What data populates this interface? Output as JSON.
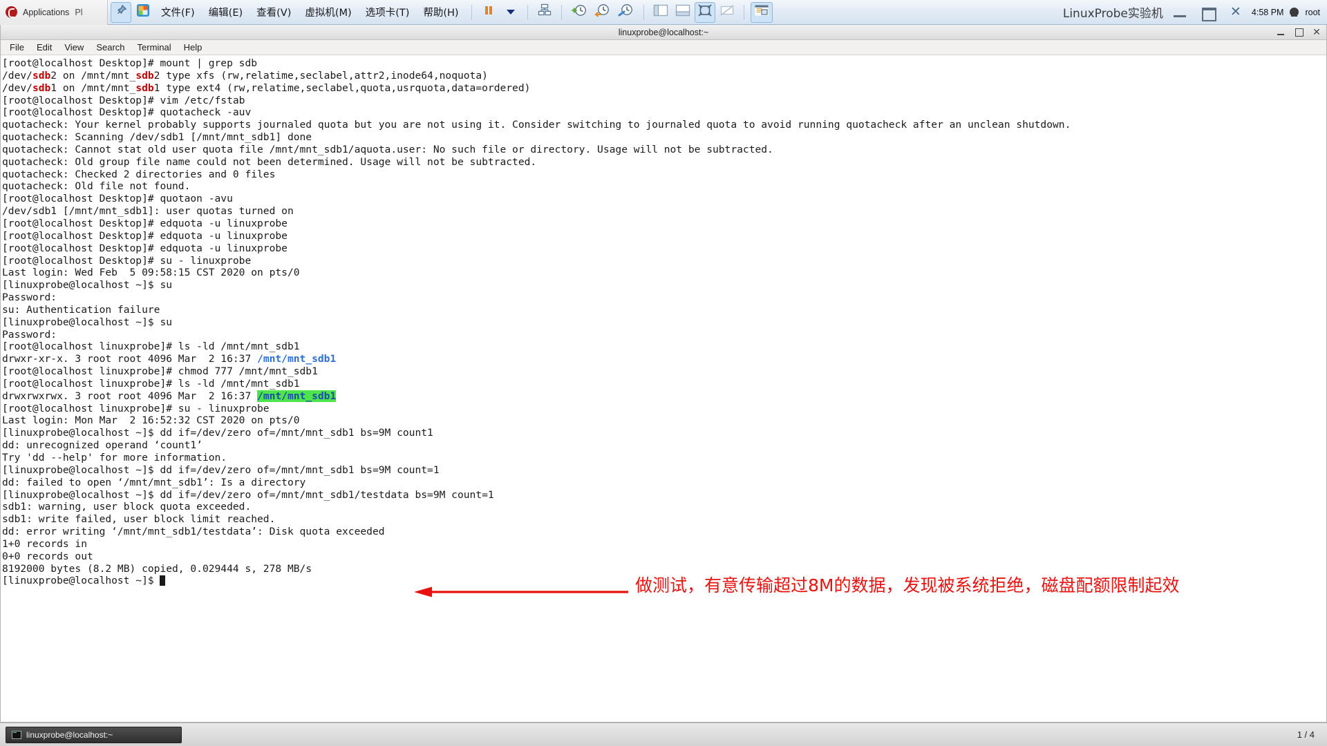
{
  "topbar": {
    "gnome": {
      "logo_icon": "fedora-logo-icon",
      "applications_label": "Applications",
      "places_label": "Pl"
    },
    "vm_toolbar": {
      "pin_icon": "pin-icon",
      "app_icon": "vmware-app-icon",
      "menus": [
        {
          "label": "文件(F)",
          "mnemonic": "F",
          "name": "menu-file"
        },
        {
          "label": "编辑(E)",
          "mnemonic": "E",
          "name": "menu-edit"
        },
        {
          "label": "查看(V)",
          "mnemonic": "V",
          "name": "menu-view"
        },
        {
          "label": "虚拟机(M)",
          "mnemonic": "M",
          "name": "menu-vm"
        },
        {
          "label": "选项卡(T)",
          "mnemonic": "T",
          "name": "menu-tabs"
        },
        {
          "label": "帮助(H)",
          "mnemonic": "H",
          "name": "menu-help"
        }
      ],
      "buttons": [
        {
          "name": "suspend-button",
          "icon": "pause-icon"
        },
        {
          "name": "power-dropdown-button",
          "icon": "chevron-down-icon"
        },
        {
          "name": "snapshot-manager-button",
          "icon": "snapshot-icon"
        },
        {
          "name": "take-snapshot-button",
          "icon": "snapshot-add-icon"
        },
        {
          "name": "revert-snapshot-button",
          "icon": "snapshot-revert-icon"
        },
        {
          "name": "manage-snapshots-button",
          "icon": "snapshot-manage-icon"
        },
        {
          "name": "show-sidebar-button",
          "icon": "sidebar-icon"
        },
        {
          "name": "show-thumbnail-button",
          "icon": "thumbnail-bar-icon"
        },
        {
          "name": "fullscreen-button",
          "icon": "fullscreen-icon"
        },
        {
          "name": "unity-mode-button",
          "icon": "unity-mode-icon"
        },
        {
          "name": "console-view-button",
          "icon": "console-view-icon"
        }
      ]
    },
    "vm_title": "LinuxProbe实验机",
    "window_controls": [
      {
        "name": "window-minimize-button",
        "icon": "minimize-icon"
      },
      {
        "name": "window-restore-button",
        "icon": "restore-icon"
      },
      {
        "name": "window-close-button",
        "icon": "close-icon"
      }
    ],
    "clock": "4:58 PM",
    "user": "root",
    "user_avatar_icon": "user-avatar-icon"
  },
  "terminal_window": {
    "title": "linuxprobe@localhost:~",
    "window_buttons": [
      {
        "name": "terminal-minimize-button",
        "icon": "minimize-icon"
      },
      {
        "name": "terminal-maximize-button",
        "icon": "maximize-icon"
      },
      {
        "name": "terminal-close-button",
        "icon": "close-icon"
      }
    ],
    "menus": [
      {
        "label": "File",
        "name": "terminal-menu-file"
      },
      {
        "label": "Edit",
        "name": "terminal-menu-edit"
      },
      {
        "label": "View",
        "name": "terminal-menu-view"
      },
      {
        "label": "Search",
        "name": "terminal-menu-search"
      },
      {
        "label": "Terminal",
        "name": "terminal-menu-terminal"
      },
      {
        "label": "Help",
        "name": "terminal-menu-help"
      }
    ],
    "lines": [
      [
        {
          "t": "[root@localhost Desktop]# mount | grep sdb"
        }
      ],
      [
        {
          "t": "/dev/"
        },
        {
          "t": "sdb",
          "c": "red"
        },
        {
          "t": "2 on /mnt/mnt_"
        },
        {
          "t": "sdb",
          "c": "red"
        },
        {
          "t": "2 type xfs (rw,relatime,seclabel,attr2,inode64,noquota)"
        }
      ],
      [
        {
          "t": "/dev/"
        },
        {
          "t": "sdb",
          "c": "red"
        },
        {
          "t": "1 on /mnt/mnt_"
        },
        {
          "t": "sdb",
          "c": "red"
        },
        {
          "t": "1 type ext4 (rw,relatime,seclabel,quota,usrquota,data=ordered)"
        }
      ],
      [
        {
          "t": "[root@localhost Desktop]# vim /etc/fstab"
        }
      ],
      [
        {
          "t": "[root@localhost Desktop]# quotacheck -auv"
        }
      ],
      [
        {
          "t": "quotacheck: Your kernel probably supports journaled quota but you are not using it. Consider switching to journaled quota to avoid running quotacheck after an unclean shutdown."
        }
      ],
      [
        {
          "t": "quotacheck: Scanning /dev/sdb1 [/mnt/mnt_sdb1] done"
        }
      ],
      [
        {
          "t": "quotacheck: Cannot stat old user quota file /mnt/mnt_sdb1/aquota.user: No such file or directory. Usage will not be subtracted."
        }
      ],
      [
        {
          "t": "quotacheck: Old group file name could not been determined. Usage will not be subtracted."
        }
      ],
      [
        {
          "t": "quotacheck: Checked 2 directories and 0 files"
        }
      ],
      [
        {
          "t": "quotacheck: Old file not found."
        }
      ],
      [
        {
          "t": "[root@localhost Desktop]# quotaon -avu"
        }
      ],
      [
        {
          "t": "/dev/sdb1 [/mnt/mnt_sdb1]: user quotas turned on"
        }
      ],
      [
        {
          "t": "[root@localhost Desktop]# edquota -u linuxprobe"
        }
      ],
      [
        {
          "t": "[root@localhost Desktop]# edquota -u linuxprobe"
        }
      ],
      [
        {
          "t": "[root@localhost Desktop]# edquota -u linuxprobe"
        }
      ],
      [
        {
          "t": "[root@localhost Desktop]# su - linuxprobe"
        }
      ],
      [
        {
          "t": "Last login: Wed Feb  5 09:58:15 CST 2020 on pts/0"
        }
      ],
      [
        {
          "t": "[linuxprobe@localhost ~]$ su"
        }
      ],
      [
        {
          "t": "Password:"
        }
      ],
      [
        {
          "t": "su: Authentication failure"
        }
      ],
      [
        {
          "t": "[linuxprobe@localhost ~]$ su"
        }
      ],
      [
        {
          "t": "Password:"
        }
      ],
      [
        {
          "t": "[root@localhost linuxprobe]# ls -ld /mnt/mnt_sdb1"
        }
      ],
      [
        {
          "t": "drwxr-xr-x. 3 root root 4096 Mar  2 16:37 "
        },
        {
          "t": "/mnt/mnt_sdb1",
          "c": "blue"
        }
      ],
      [
        {
          "t": "[root@localhost linuxprobe]# chmod 777 /mnt/mnt_sdb1"
        }
      ],
      [
        {
          "t": "[root@localhost linuxprobe]# ls -ld /mnt/mnt_sdb1"
        }
      ],
      [
        {
          "t": "drwxrwxrwx. 3 root root 4096 Mar  2 16:37 "
        },
        {
          "t": "/mnt/mnt_sdb1",
          "c": "hl"
        }
      ],
      [
        {
          "t": "[root@localhost linuxprobe]# su - linuxprobe"
        }
      ],
      [
        {
          "t": "Last login: Mon Mar  2 16:52:32 CST 2020 on pts/0"
        }
      ],
      [
        {
          "t": "[linuxprobe@localhost ~]$ dd if=/dev/zero of=/mnt/mnt_sdb1 bs=9M count1"
        }
      ],
      [
        {
          "t": "dd: unrecognized operand ‘count1’"
        }
      ],
      [
        {
          "t": "Try 'dd --help' for more information."
        }
      ],
      [
        {
          "t": "[linuxprobe@localhost ~]$ dd if=/dev/zero of=/mnt/mnt_sdb1 bs=9M count=1"
        }
      ],
      [
        {
          "t": "dd: failed to open ‘/mnt/mnt_sdb1’: Is a directory"
        }
      ],
      [
        {
          "t": "[linuxprobe@localhost ~]$ dd if=/dev/zero of=/mnt/mnt_sdb1/testdata bs=9M count=1"
        }
      ],
      [
        {
          "t": "sdb1: warning, user block quota exceeded."
        }
      ],
      [
        {
          "t": "sdb1: write failed, user block limit reached."
        }
      ],
      [
        {
          "t": "dd: error writing ‘/mnt/mnt_sdb1/testdata’: Disk quota exceeded"
        }
      ],
      [
        {
          "t": "1+0 records in"
        }
      ],
      [
        {
          "t": "0+0 records out"
        }
      ],
      [
        {
          "t": "8192000 bytes (8.2 MB) copied, 0.029444 s, 278 MB/s"
        }
      ],
      [
        {
          "t": "[linuxprobe@localhost ~]$ "
        },
        {
          "t": "",
          "cursor": true
        }
      ]
    ]
  },
  "annotation": {
    "arrow_icon": "red-arrow-left-icon",
    "color": "#e8110e",
    "text": "做测试，有意传输超过8M的数据，发现被系统拒绝，磁盘配额限制起效"
  },
  "taskbar": {
    "window_button": {
      "icon": "terminal-icon",
      "label": "linuxprobe@localhost:~"
    },
    "workspace_indicator": "1 / 4"
  }
}
